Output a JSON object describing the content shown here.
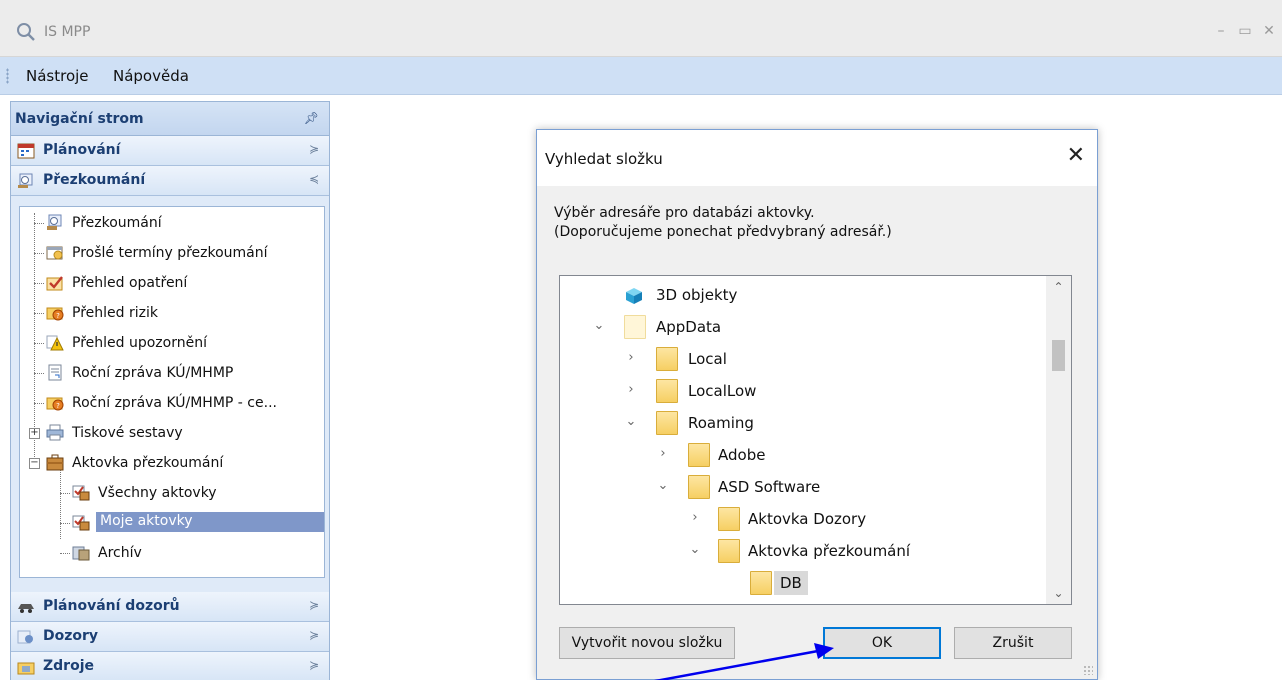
{
  "window": {
    "title": "IS MPP",
    "icons": {
      "app": "search-icon",
      "minimize": "minimize-icon",
      "maximize": "maximize-icon",
      "close": "close-icon"
    }
  },
  "menu": {
    "items": [
      "Nástroje",
      "Nápověda"
    ]
  },
  "nav": {
    "header": "Navigační strom",
    "pin_icon": "pin-icon",
    "sections_top": [
      {
        "label": "Plánování",
        "icon": "calendar-icon",
        "state": "collapsed"
      },
      {
        "label": "Přezkoumání",
        "icon": "magnifier-person-icon",
        "state": "expanded"
      }
    ],
    "tree": [
      {
        "label": "Přezkoumání",
        "icon": "magnifier-person-icon"
      },
      {
        "label": "Prošlé termíny přezkoumání",
        "icon": "calendar-alert-icon"
      },
      {
        "label": "Přehled opatření",
        "icon": "checkbox-icon"
      },
      {
        "label": "Přehled rizik",
        "icon": "risk-folder-icon"
      },
      {
        "label": "Přehled upozornění",
        "icon": "warning-icon"
      },
      {
        "label": "Roční zpráva KÚ/MHMP",
        "icon": "report-icon"
      },
      {
        "label": "Roční zpráva KÚ/MHMP - ce...",
        "icon": "risk-folder-icon"
      },
      {
        "label": "Tiskové sestavy",
        "icon": "print-icon",
        "expander": "+"
      },
      {
        "label": "Aktovka přezkoumání",
        "icon": "briefcase-icon",
        "expander": "−"
      },
      {
        "label": "Všechny aktovky",
        "icon": "briefcase-check-icon",
        "child": true
      },
      {
        "label": "Moje aktovky",
        "icon": "briefcase-check-icon",
        "child": true,
        "selected": true
      },
      {
        "label": "Archív",
        "icon": "archive-icon",
        "child": true
      }
    ],
    "sections_bottom": [
      {
        "label": "Plánování dozorů",
        "icon": "car-icon"
      },
      {
        "label": "Dozory",
        "icon": "dozor-icon"
      },
      {
        "label": "Zdroje",
        "icon": "folder-icon"
      }
    ]
  },
  "dialog": {
    "title": "Vyhledat složku",
    "close_label": "✕",
    "description_line1": "Výběr adresáře pro databázi aktovky.",
    "description_line2": "(Doporučujeme ponechat předvybraný adresář.)",
    "folders": [
      {
        "label": "3D objekty",
        "arrow": "",
        "icon": "3d-objects-icon",
        "level": 1
      },
      {
        "label": "AppData",
        "arrow": "⌄",
        "icon": "folder-icon-light",
        "level": 1
      },
      {
        "label": "Local",
        "arrow": "›",
        "icon": "folder-icon",
        "level": 2
      },
      {
        "label": "LocalLow",
        "arrow": "›",
        "icon": "folder-icon",
        "level": 2
      },
      {
        "label": "Roaming",
        "arrow": "⌄",
        "icon": "folder-icon",
        "level": 2
      },
      {
        "label": "Adobe",
        "arrow": "›",
        "icon": "folder-icon",
        "level": 3
      },
      {
        "label": "ASD Software",
        "arrow": "⌄",
        "icon": "folder-icon",
        "level": 3
      },
      {
        "label": "Aktovka Dozory",
        "arrow": "›",
        "icon": "folder-icon",
        "level": 4
      },
      {
        "label": "Aktovka přezkoumání",
        "arrow": "⌄",
        "icon": "folder-icon",
        "level": 4
      },
      {
        "label": "DB",
        "arrow": "",
        "icon": "folder-icon",
        "level": 5,
        "selected": true
      }
    ],
    "buttons": {
      "new_folder": "Vytvořit novou složku",
      "ok": "OK",
      "cancel": "Zrušit"
    }
  },
  "colors": {
    "accent": "#0078d7",
    "annotation_arrow": "#0000ee",
    "nav_text": "#1c3f73",
    "selection": "#7f97c9"
  }
}
